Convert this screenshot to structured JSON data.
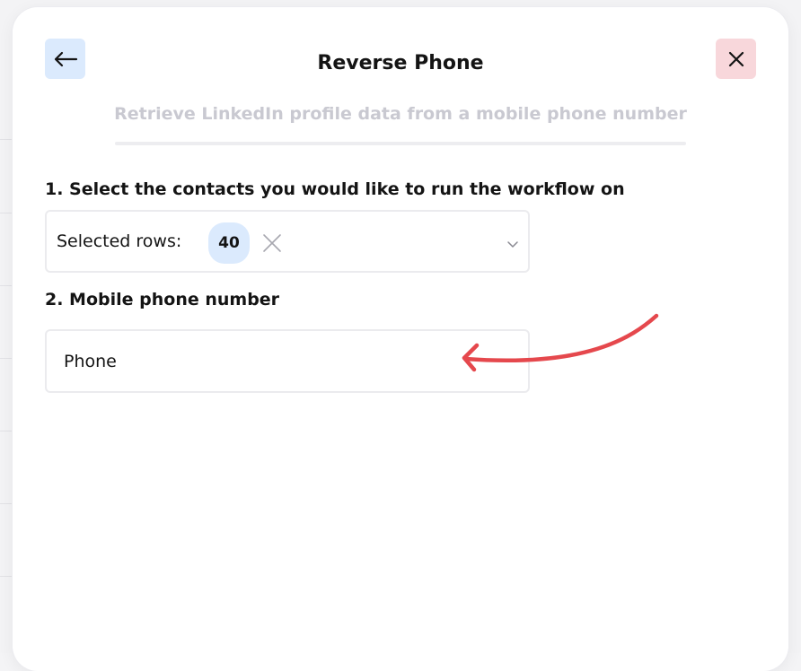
{
  "modal": {
    "title": "Reverse Phone",
    "subtitle": "Retrieve LinkedIn profile data from a mobile phone number"
  },
  "header": {
    "back_icon": "arrow-left-icon",
    "close_icon": "close-icon"
  },
  "step1": {
    "label": "1. Select the contacts you would like to run the workflow on",
    "select_label": "Selected rows:",
    "selected_count": "40",
    "clear_icon": "close-icon",
    "dropdown_icon": "chevron-down-icon"
  },
  "step2": {
    "label": "2.  Mobile phone number",
    "field_value": "Phone"
  },
  "colors": {
    "back_button_bg": "#dbeafd",
    "close_button_bg": "#f8d7db",
    "annotation_arrow": "#e5484d"
  }
}
